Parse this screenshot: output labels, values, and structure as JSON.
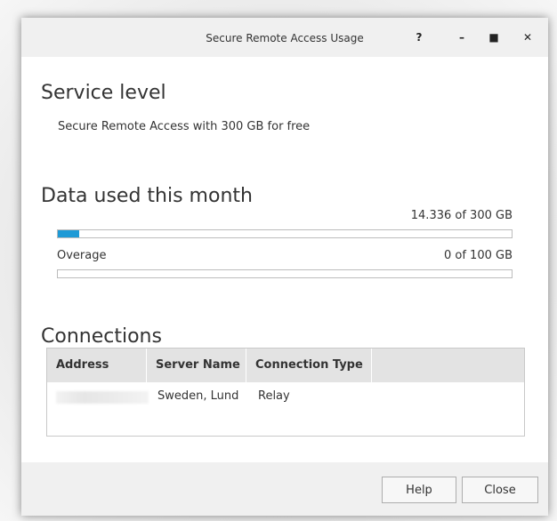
{
  "window": {
    "title": "Secure Remote Access Usage",
    "help_glyph": "?",
    "min_glyph": "–",
    "max_glyph": "■",
    "close_glyph": "✕"
  },
  "service": {
    "heading": "Service level",
    "description": "Secure Remote Access with 300 GB for free"
  },
  "data_usage": {
    "heading": "Data used this month",
    "used_text": "14.336 of 300 GB",
    "used_fraction": 0.048,
    "overage_label": "Overage",
    "overage_text": "0 of 100 GB",
    "overage_fraction": 0,
    "accent_color": "#1e9ad6"
  },
  "connections": {
    "heading": "Connections",
    "columns": [
      "Address",
      "Server Name",
      "Connection Type"
    ],
    "rows": [
      {
        "address": "",
        "server_name": "Sweden, Lund",
        "connection_type": "Relay"
      }
    ]
  },
  "footer": {
    "help_label": "Help",
    "close_label": "Close"
  }
}
